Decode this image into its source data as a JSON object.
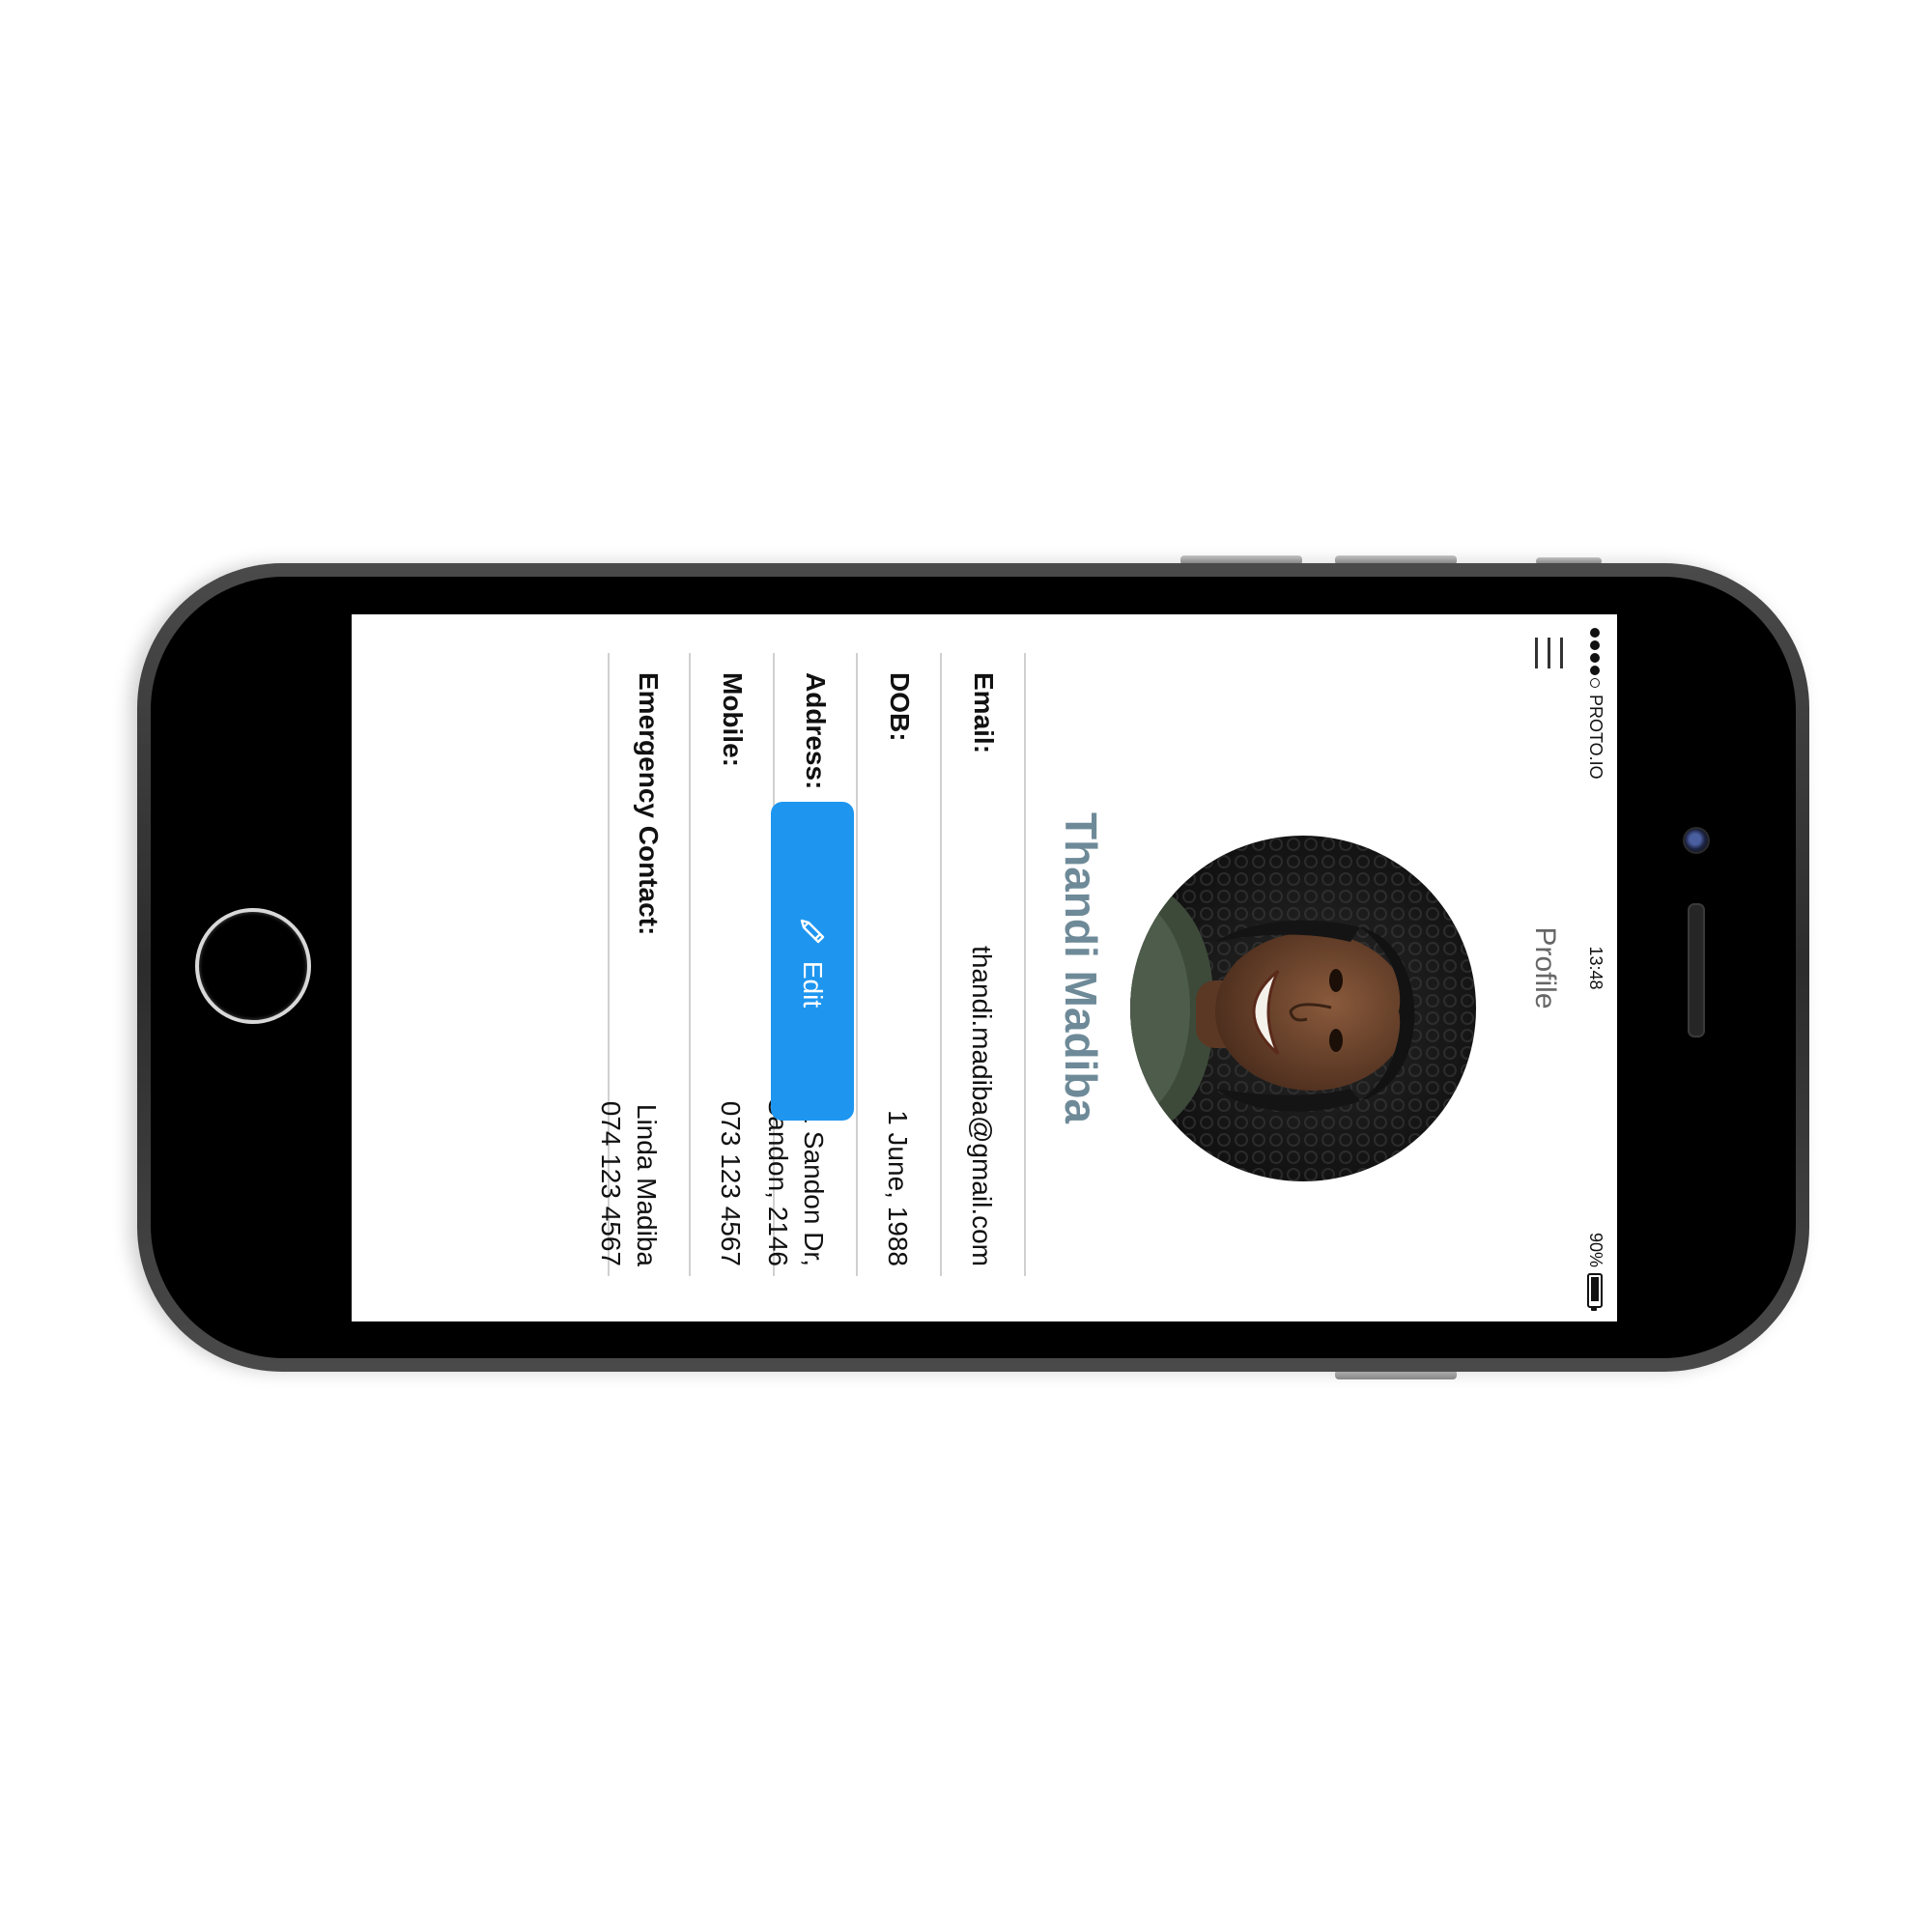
{
  "status_bar": {
    "carrier": "PROTO.IO",
    "time": "13:48",
    "battery": "90%",
    "battery_level": 0.9
  },
  "nav": {
    "title": "Profile",
    "menu_icon": "hamburger-menu-icon"
  },
  "profile": {
    "name": "Thandi Madiba",
    "avatar": "profile-photo",
    "fields": [
      {
        "label": "Email:",
        "value": "thandi.madiba@gmail.com"
      },
      {
        "label": "DOB:",
        "value": "1 June, 1988"
      },
      {
        "label": "Address:",
        "value_lines": [
          "1 Sandon Dr,",
          "Sandon, 2146"
        ]
      },
      {
        "label": "Mobile:",
        "value": "073 123 4567"
      },
      {
        "label": "Emergency Contact:",
        "value_lines": [
          "Linda Madiba",
          "074 123 4567"
        ]
      }
    ]
  },
  "actions": {
    "edit_label": "Edit",
    "edit_icon": "pencil-icon"
  },
  "colors": {
    "accent_button": "#1e96f0",
    "name_text": "#6e8a98",
    "divider": "#d0d0d0",
    "phone_body": "#3a3a3a"
  }
}
